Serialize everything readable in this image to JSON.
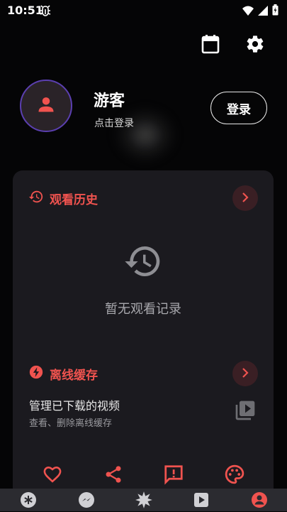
{
  "status": {
    "time": "10:51"
  },
  "profile": {
    "name": "游客",
    "subtitle": "点击登录",
    "login_label": "登录"
  },
  "history": {
    "title": "观看历史",
    "empty_text": "暂无观看记录"
  },
  "offline": {
    "title": "离线缓存",
    "item_title": "管理已下载的视频",
    "item_sub": "查看、删除离线缓存"
  },
  "colors": {
    "accent": "#f0534f",
    "card": "#1b1a1f",
    "nav": "#2b2b30",
    "avatar_ring": "#5b3fb0"
  },
  "icons": {
    "top": [
      "calendar-icon",
      "gear-icon"
    ],
    "actions": [
      "heart-icon",
      "share-icon",
      "feedback-icon",
      "palette-icon"
    ],
    "nav": [
      "asterisk-icon",
      "messenger-icon",
      "sparkle-icon",
      "play-icon",
      "profile-icon"
    ]
  }
}
